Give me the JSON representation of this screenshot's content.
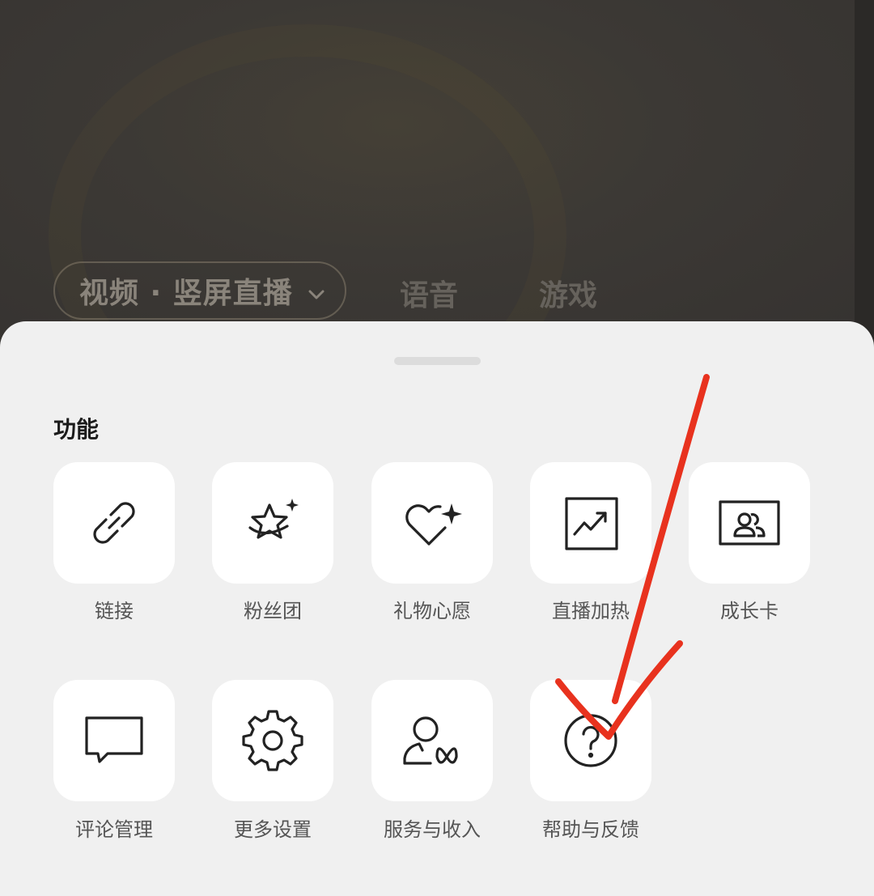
{
  "background": {
    "mode_selector": {
      "label": "视频 · 竖屏直播",
      "chevron": "chevron-down-icon"
    },
    "tabs": [
      {
        "label": "语音"
      },
      {
        "label": "游戏"
      }
    ]
  },
  "sheet": {
    "section_title": "功能",
    "items": [
      {
        "label": "链接",
        "icon": "link-icon"
      },
      {
        "label": "粉丝团",
        "icon": "star-sparkle-icon"
      },
      {
        "label": "礼物心愿",
        "icon": "heart-sparkle-icon"
      },
      {
        "label": "直播加热",
        "icon": "trend-chart-icon"
      },
      {
        "label": "成长卡",
        "icon": "user-card-icon"
      },
      {
        "label": "评论管理",
        "icon": "comment-icon"
      },
      {
        "label": "更多设置",
        "icon": "gear-icon"
      },
      {
        "label": "服务与收入",
        "icon": "user-butterfly-icon"
      },
      {
        "label": "帮助与反馈",
        "icon": "help-circle-icon"
      }
    ]
  },
  "colors": {
    "annotation": "#e8321e",
    "sheet_bg": "#f0f0f0",
    "tile_bg": "#ffffff"
  }
}
